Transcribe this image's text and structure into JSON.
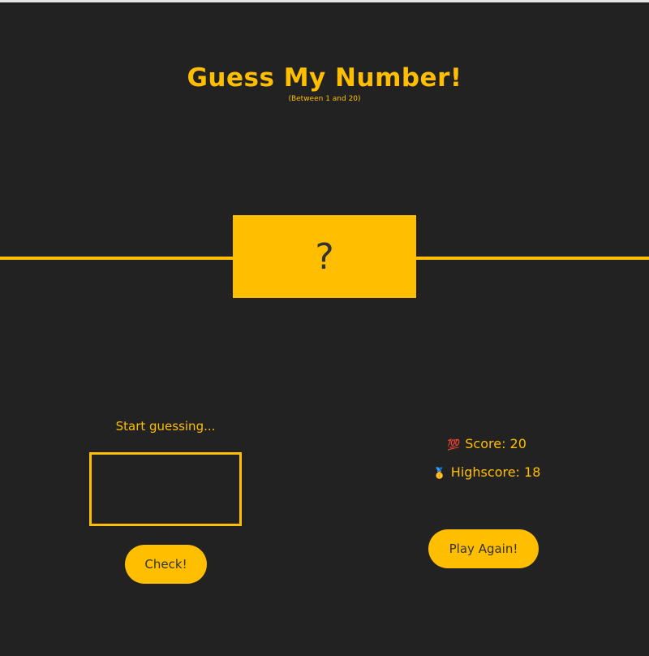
{
  "header": {
    "title": "Guess My Number!",
    "subtitle": "(Between 1 and 20)"
  },
  "secret_box": {
    "value": "?"
  },
  "left_panel": {
    "message": "Start guessing...",
    "guess_input_value": "",
    "check_label": "Check!"
  },
  "right_panel": {
    "score_icon": "💯",
    "score_text": "Score: 20",
    "highscore_icon": "🥇",
    "highscore_text": "Highscore: 18",
    "play_again_label": "Play Again!"
  },
  "colors": {
    "background": "#222222",
    "accent": "#ffbf00",
    "dark_text": "#333333"
  }
}
